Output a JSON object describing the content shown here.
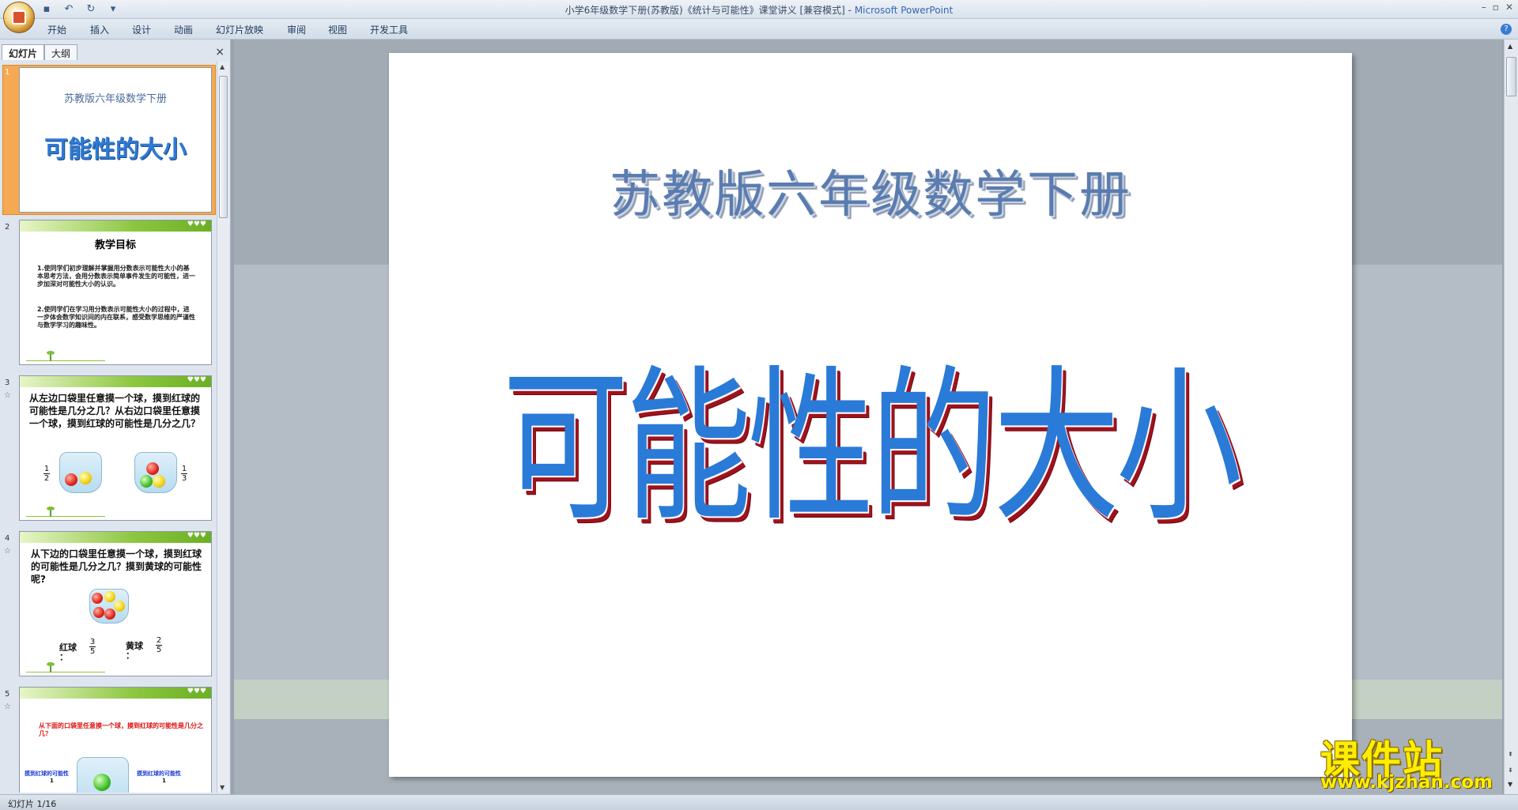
{
  "window": {
    "title_doc": "小学6年级数学下册(苏教版)《统计与可能性》课堂讲义 [兼容模式] - ",
    "title_app": "Microsoft PowerPoint"
  },
  "ribbon": {
    "tabs": [
      "开始",
      "插入",
      "设计",
      "动画",
      "幻灯片放映",
      "审阅",
      "视图",
      "开发工具"
    ]
  },
  "left_pane": {
    "tab_slides": "幻灯片",
    "tab_outline": "大纲",
    "close": "×"
  },
  "thumbs": {
    "s1": {
      "num": "1",
      "subtitle": "苏教版六年级数学下册",
      "title": "可能性的大小"
    },
    "s2": {
      "num": "2",
      "title": "教学目标",
      "p1": "1.使同学们初步理解并掌握用分数表示可能性大小的基本思考方法，会用分数表示简单事件发生的可能性，进一步加深对可能性大小的认识。",
      "p2": "2.使同学们在学习用分数表示可能性大小的过程中，进一步体会数学知识间的内在联系，感受数学思维的严谨性与数学学习的趣味性。"
    },
    "s3": {
      "num": "3",
      "text": "从左边口袋里任意摸一个球，摸到红球的可能性是几分之几？从右边口袋里任意摸一个球，摸到红球的可能性是几分之几？",
      "frac_left_n": "1",
      "frac_left_d": "2",
      "frac_right_n": "1",
      "frac_right_d": "3"
    },
    "s4": {
      "num": "4",
      "text": "从下边的口袋里任意摸一个球，摸到红球的可能性是几分之几？摸到黄球的可能性呢?",
      "label_red": "红球",
      "label_yellow": "黄球",
      "colon": "：",
      "frac_red_n": "3",
      "frac_red_d": "5",
      "frac_yellow_n": "2",
      "frac_yellow_d": "5"
    },
    "s5": {
      "num": "5",
      "text": "从下面的口袋里任意摸一个球，摸到红球的可能性是几分之几？",
      "small_left": "摸到红球的可能性",
      "small_right": "摸到红球的可能性",
      "frac_left_n": "1",
      "frac_right_n": "1"
    }
  },
  "slide": {
    "subtitle": "苏教版六年级数学下册",
    "title": "可能性的大小"
  },
  "status": {
    "text": "幻灯片 1/16"
  },
  "watermark": {
    "big": "课件站",
    "url": "www.kjzhan.com"
  }
}
